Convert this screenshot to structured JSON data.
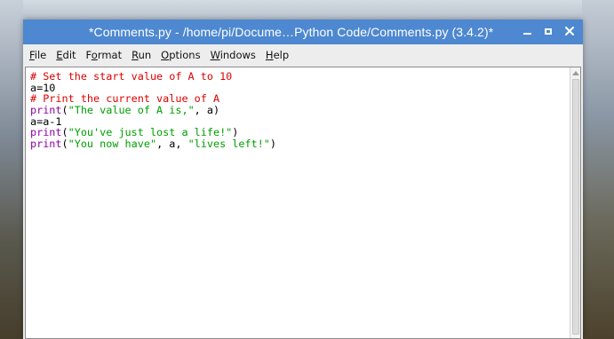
{
  "window": {
    "title": "*Comments.py - /home/pi/Docume…Python Code/Comments.py (3.4.2)*",
    "accent_color": "#4d88d1",
    "controls": [
      "minimize-icon",
      "maximize-icon",
      "close-icon"
    ]
  },
  "menubar": {
    "items": [
      {
        "mnemonic": "F",
        "rest": "ile"
      },
      {
        "mnemonic": "E",
        "rest": "dit"
      },
      {
        "pre": "F",
        "mnemonic": "o",
        "rest": "rmat"
      },
      {
        "mnemonic": "R",
        "rest": "un"
      },
      {
        "mnemonic": "O",
        "rest": "ptions"
      },
      {
        "mnemonic": "W",
        "rest": "indows"
      },
      {
        "mnemonic": "H",
        "rest": "elp"
      }
    ]
  },
  "editor": {
    "colors": {
      "comment": "#dd0000",
      "builtin": "#9000a8",
      "string": "#00a000",
      "plain": "#000000"
    },
    "lines": [
      [
        {
          "t": "# Set the start value of A to 10",
          "k": "comment"
        }
      ],
      [
        {
          "t": "a=10",
          "k": "plain"
        }
      ],
      [
        {
          "t": "# Print the current value of A",
          "k": "comment"
        }
      ],
      [
        {
          "t": "print",
          "k": "builtin"
        },
        {
          "t": "(",
          "k": "plain"
        },
        {
          "t": "\"The value of A is,\"",
          "k": "string"
        },
        {
          "t": ", a)",
          "k": "plain"
        }
      ],
      [
        {
          "t": "a=a-1",
          "k": "plain"
        }
      ],
      [
        {
          "t": "print",
          "k": "builtin"
        },
        {
          "t": "(",
          "k": "plain"
        },
        {
          "t": "\"You've just lost a life!\"",
          "k": "string"
        },
        {
          "t": ")",
          "k": "plain"
        }
      ],
      [
        {
          "t": "print",
          "k": "builtin"
        },
        {
          "t": "(",
          "k": "plain"
        },
        {
          "t": "\"You now have\"",
          "k": "string"
        },
        {
          "t": ", a, ",
          "k": "plain"
        },
        {
          "t": "\"lives left!\"",
          "k": "string"
        },
        {
          "t": ")",
          "k": "plain"
        }
      ]
    ]
  }
}
